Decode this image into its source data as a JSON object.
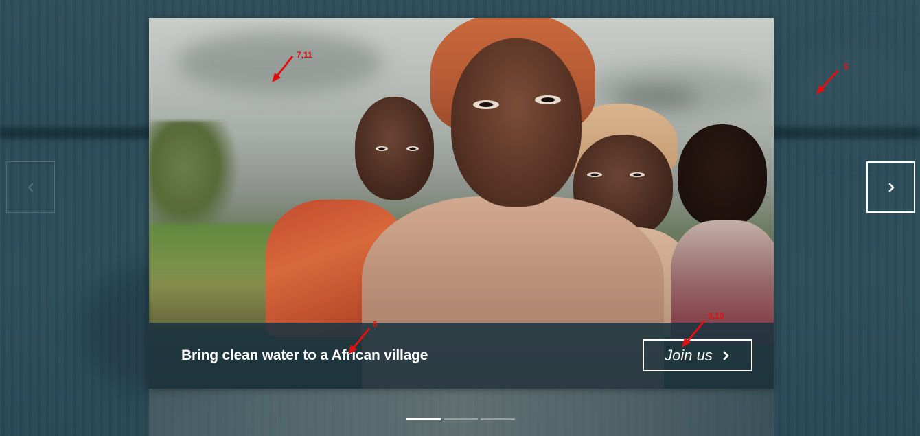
{
  "slider": {
    "slide": {
      "caption": "Bring clean water to a African village",
      "cta_label": "Join us",
      "image_subject": "children-in-african-village-photo"
    },
    "prev_icon": "chevron-left-icon",
    "next_icon": "chevron-right-icon",
    "cta_icon": "chevron-right-icon",
    "dots": [
      {
        "state": "active"
      },
      {
        "state": "inactive"
      },
      {
        "state": "inactive"
      }
    ]
  },
  "annotations": [
    {
      "label": "7,11"
    },
    {
      "label": "5"
    },
    {
      "label": "6"
    },
    {
      "label": "9,10"
    }
  ],
  "colors": {
    "background": "#2b4a57",
    "caption_bar": "#1c3440",
    "text": "#ffffff",
    "annotation": "#e01010"
  }
}
